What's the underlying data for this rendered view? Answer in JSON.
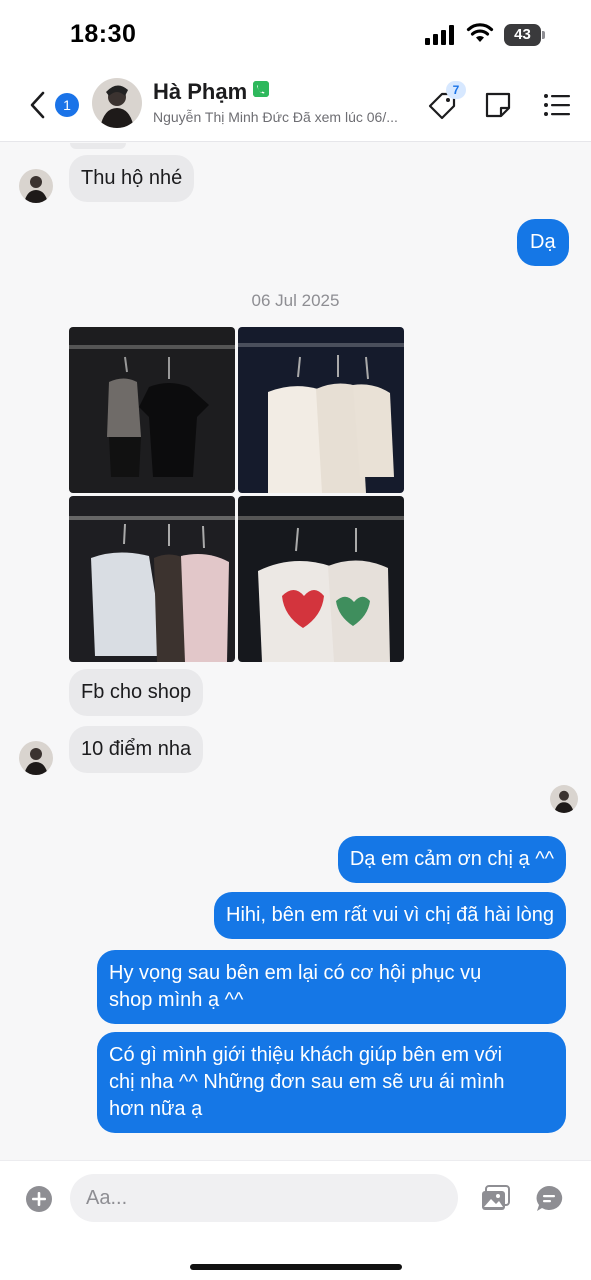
{
  "status_bar": {
    "time": "18:30",
    "battery": "43"
  },
  "header": {
    "unread_count": "1",
    "contact_name": "Hà Phạm",
    "contact_subtitle": "Nguyễn Thị Minh Đức Đã xem lúc 06/...",
    "tag_count": "7",
    "icons": [
      "back-icon",
      "phone-icon",
      "tag-icon",
      "note-icon",
      "menu-icon"
    ]
  },
  "chat": {
    "date_separator": "06 Jul 2025",
    "messages": [
      {
        "from": "contact",
        "text": "Thu hộ nhé"
      },
      {
        "from": "me",
        "text": "Dạ"
      },
      {
        "from": "contact",
        "type": "photos",
        "count": 4
      },
      {
        "from": "contact",
        "text": "Fb cho shop"
      },
      {
        "from": "contact",
        "text": "10 điểm nha"
      },
      {
        "from": "me",
        "text": "Dạ em cảm ơn chị ạ ^^"
      },
      {
        "from": "me",
        "text": "Hihi, bên em rất vui vì chị đã hài lòng"
      },
      {
        "from": "me",
        "lines": [
          "Hy vọng sau bên em lại có cơ hội phục vụ",
          "shop mình ạ ^^"
        ]
      },
      {
        "from": "me",
        "lines": [
          "Có gì mình giới thiệu khách giúp bên em với",
          "chị nha ^^ Những đơn sau em sẽ ưu ái mình",
          "hơn nữa ạ"
        ]
      }
    ]
  },
  "input_bar": {
    "placeholder": "Aa...",
    "value": "",
    "icons": [
      "plus-icon",
      "image-icon",
      "chat-icon"
    ]
  },
  "colors": {
    "outgoing_bubble": "#1577e6",
    "incoming_bubble": "#e9e9eb",
    "accent": "#1a73e8",
    "background": "#f7f7f8"
  }
}
